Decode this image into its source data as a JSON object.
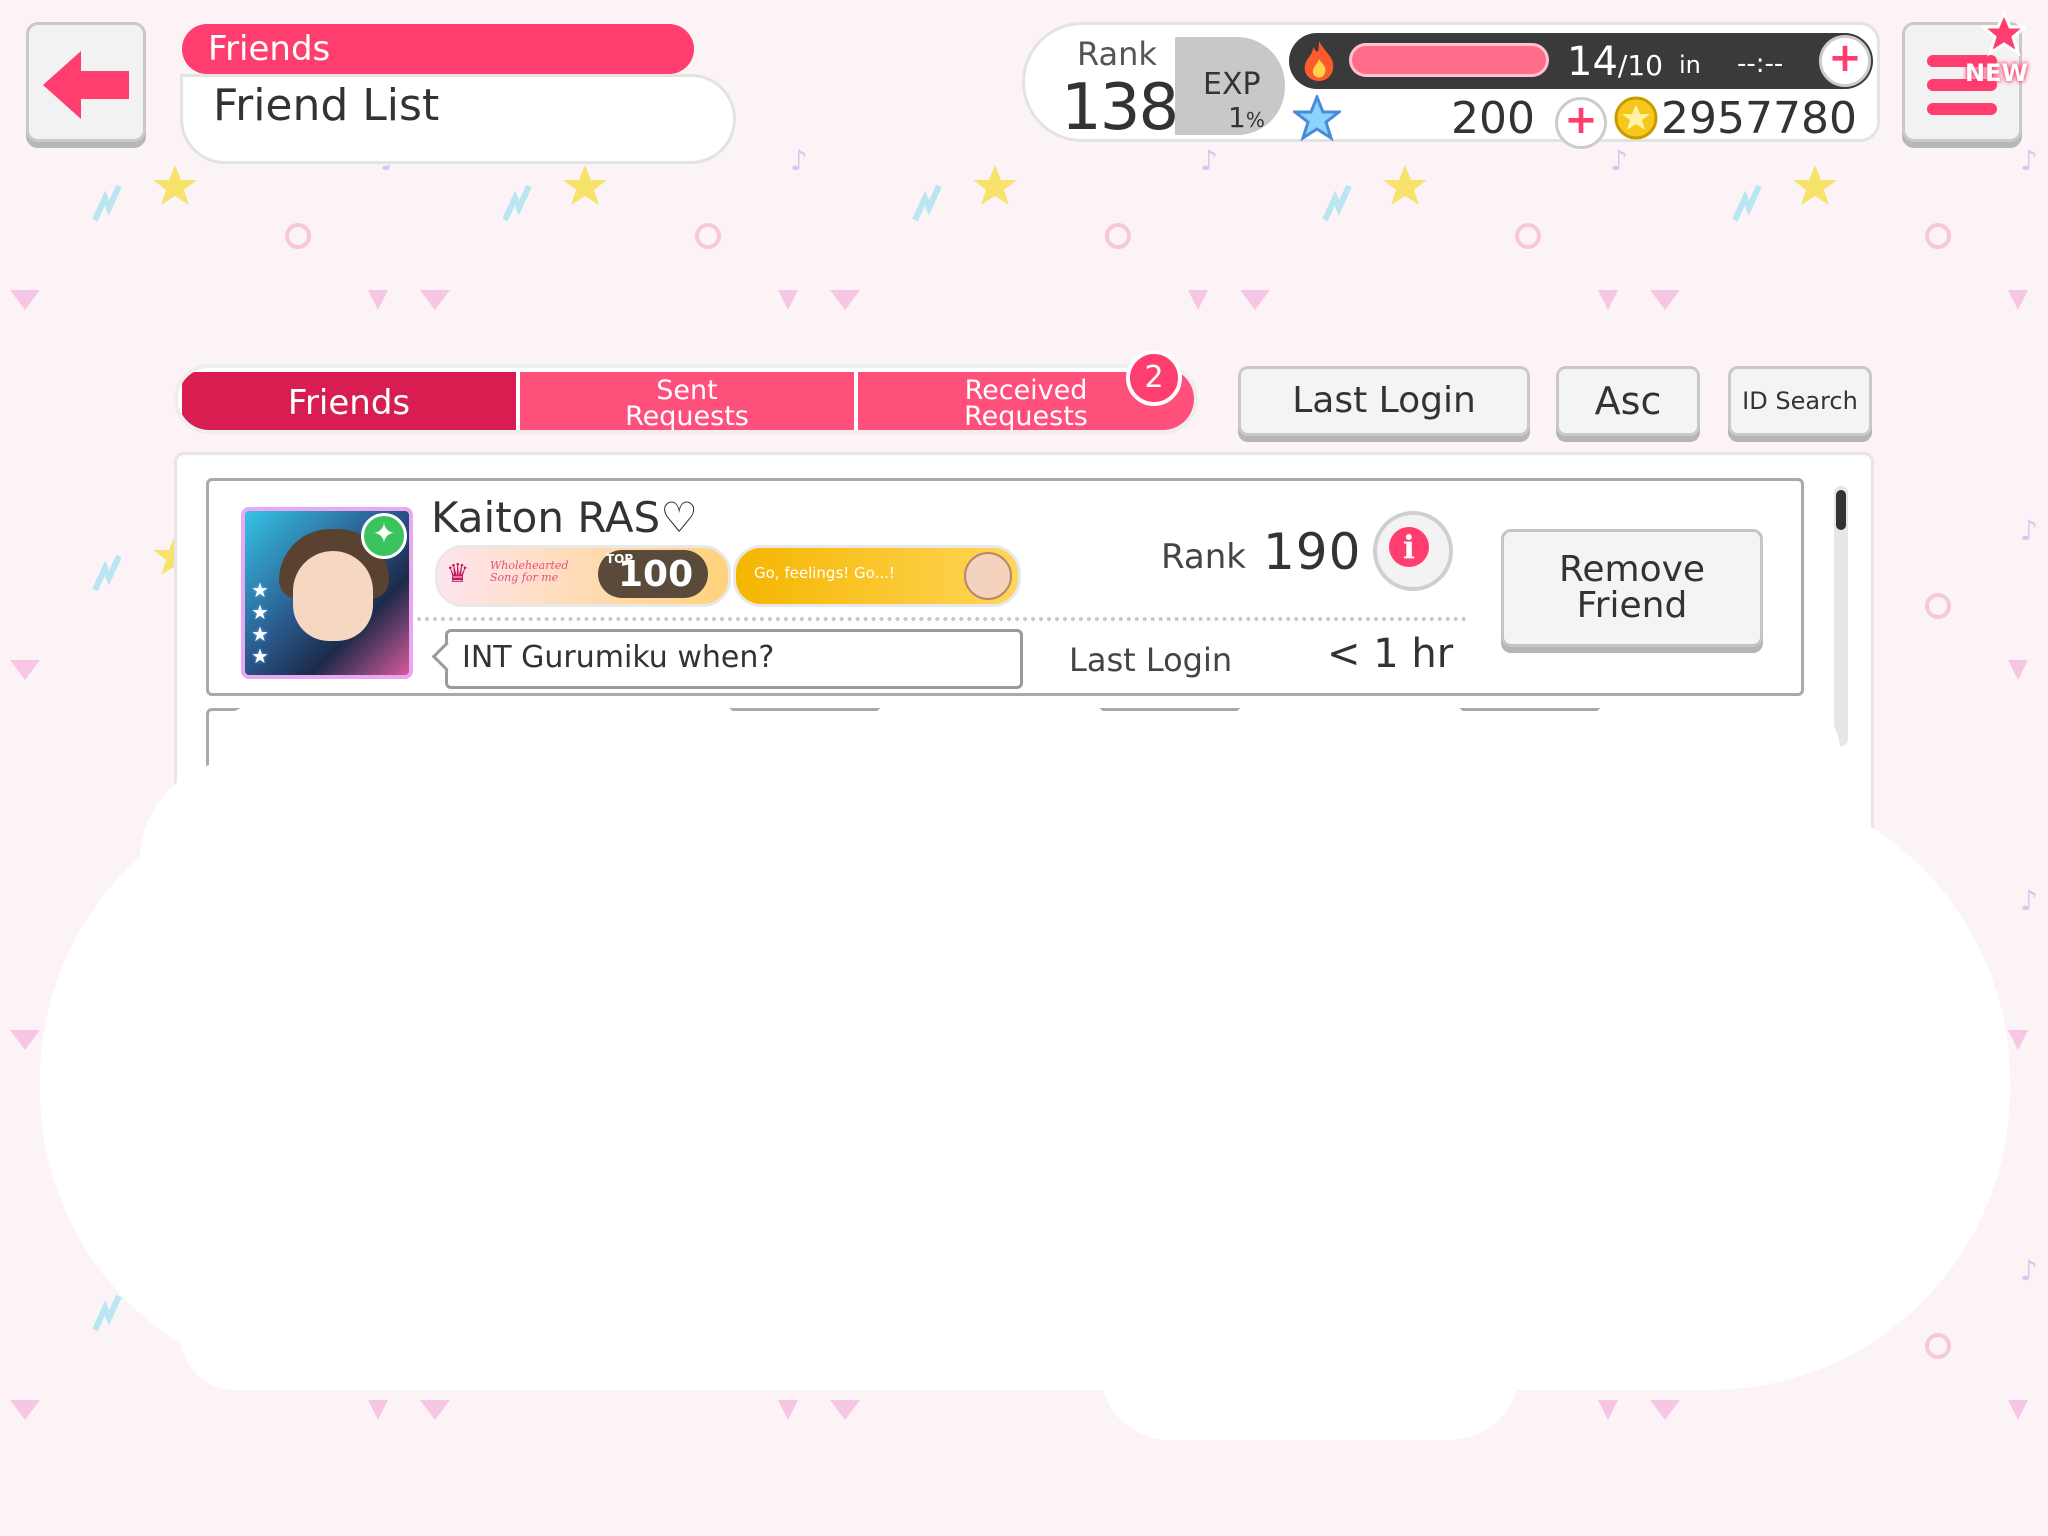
{
  "header": {
    "category": "Friends",
    "title": "Friend List"
  },
  "status": {
    "rank_label": "Rank",
    "rank_value": "138",
    "exp_label": "EXP",
    "exp_value": "1",
    "exp_unit": "%",
    "stamina_current": "14",
    "stamina_max": "/10",
    "stamina_in_label": "in",
    "stamina_timer": "--:--",
    "stars": "200",
    "coins": "2957780"
  },
  "menu": {
    "new_label": "NEW"
  },
  "tabs": [
    {
      "label": "Friends",
      "active": true
    },
    {
      "label_line1": "Sent",
      "label_line2": "Requests",
      "active": false
    },
    {
      "label_line1": "Received",
      "label_line2": "Requests",
      "active": false
    }
  ],
  "received_count": "2",
  "sort": {
    "order_by": "Last Login",
    "direction": "Asc",
    "id_search": "ID Search"
  },
  "friends": [
    {
      "name": "Kaiton RAS♡",
      "title1_text": "Wholehearted Song for me",
      "title1_top_label": "TOP",
      "title1_top_value": "100",
      "title2_text": "Go, feelings! Go...!",
      "comment": "INT Gurumiku when?",
      "rank_label": "Rank",
      "rank_value": "190",
      "last_login_label": "Last Login",
      "last_login_value": "< 1 hr",
      "remove_line1": "Remove",
      "remove_line2": "Friend"
    }
  ],
  "colors": {
    "accent": "#ff3d6e",
    "tab_active": "#d81e50",
    "tab_inactive": "#ff4f7b",
    "background": "#fbf3f6"
  }
}
